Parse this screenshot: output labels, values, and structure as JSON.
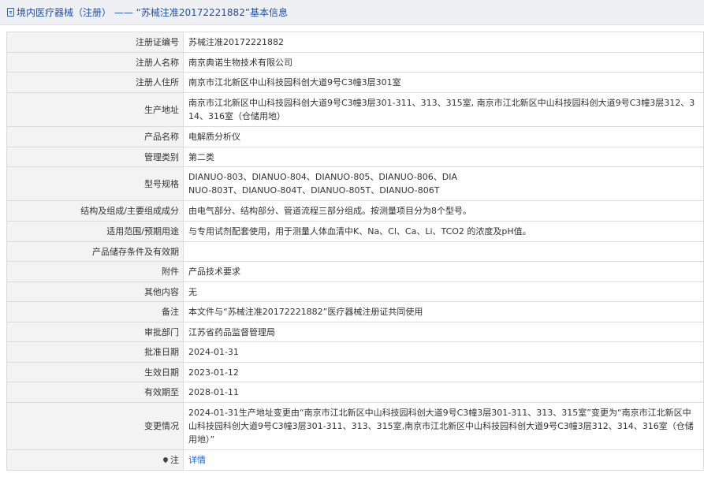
{
  "header": {
    "title": "境内医疗器械（注册） —— “苏械注准20172221882”基本信息",
    "icon": "document-icon"
  },
  "rows": [
    {
      "label": "注册证编号",
      "value": "苏械注准20172221882"
    },
    {
      "label": "注册人名称",
      "value": "南京典诺生物技术有限公司"
    },
    {
      "label": "注册人住所",
      "value": "南京市江北新区中山科技园科创大道9号C3幢3层301室"
    },
    {
      "label": "生产地址",
      "value": "南京市江北新区中山科技园科创大道9号C3幢3层301-311、313、315室, 南京市江北新区中山科技园科创大道9号C3幢3层312、314、316室（仓储用地）"
    },
    {
      "label": "产品名称",
      "value": "电解质分析仪"
    },
    {
      "label": "管理类别",
      "value": "第二类"
    },
    {
      "label": "型号规格",
      "value": "DIANUO-803、DIANUO-804、DIANUO-805、DIANUO-806、DIANUO-803T、DIANUO-804T、DIANUO-805T、DIANUO-806T"
    },
    {
      "label": "结构及组成/主要组成成分",
      "value": "由电气部分、结构部分、管道流程三部分组成。按测量项目分为8个型号。"
    },
    {
      "label": "适用范围/预期用途",
      "value": "与专用试剂配套使用，用于测量人体血清中K、Na、Cl、Ca、Li、TCO2 的浓度及pH值。"
    },
    {
      "label": "产品储存条件及有效期",
      "value": ""
    },
    {
      "label": "附件",
      "value": "产品技术要求"
    },
    {
      "label": "其他内容",
      "value": "无"
    },
    {
      "label": "备注",
      "value": "本文件与“苏械注准20172221882”医疗器械注册证共同使用"
    },
    {
      "label": "审批部门",
      "value": "江苏省药品监督管理局"
    },
    {
      "label": "批准日期",
      "value": "2024-01-31"
    },
    {
      "label": "生效日期",
      "value": "2023-01-12"
    },
    {
      "label": "有效期至",
      "value": "2028-01-11"
    },
    {
      "label": "变更情况",
      "value": "2024-01-31生产地址变更由“南京市江北新区中山科技园科创大道9号C3幢3层301-311、313、315室”变更为“南京市江北新区中山科技园科创大道9号C3幢3层301-311、313、315室,南京市江北新区中山科技园科创大道9号C3幢3层312、314、316室（仓储用地）”"
    }
  ],
  "note": {
    "label": "注",
    "icon": "location-pin-icon",
    "link_text": "详情"
  }
}
